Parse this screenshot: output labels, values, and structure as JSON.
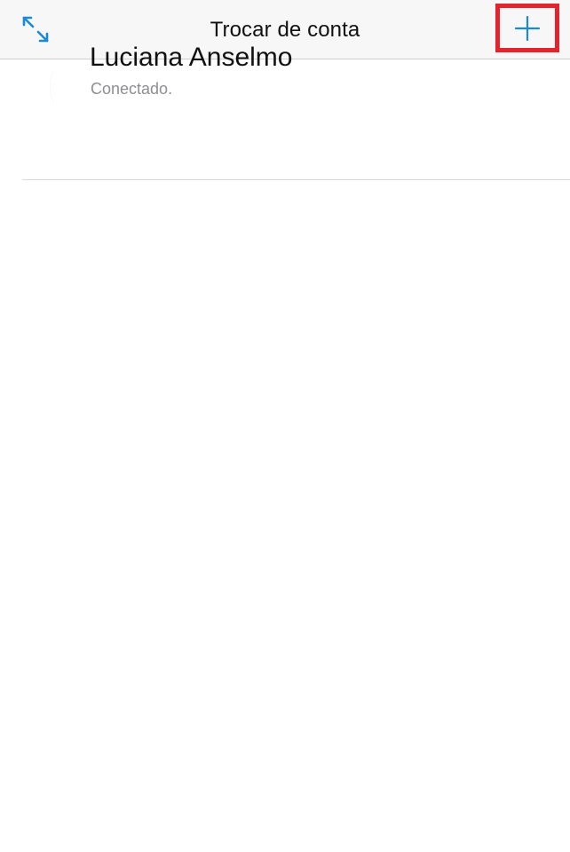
{
  "navbar": {
    "title": "Trocar de conta",
    "left_icon": "collapse-arrows-icon",
    "right_icon": "plus-icon",
    "accent_color": "#1a8ad4",
    "highlight_color": "#e3232d"
  },
  "accounts": [
    {
      "name": "Luciana Anselmo",
      "status": "Conectado."
    }
  ]
}
